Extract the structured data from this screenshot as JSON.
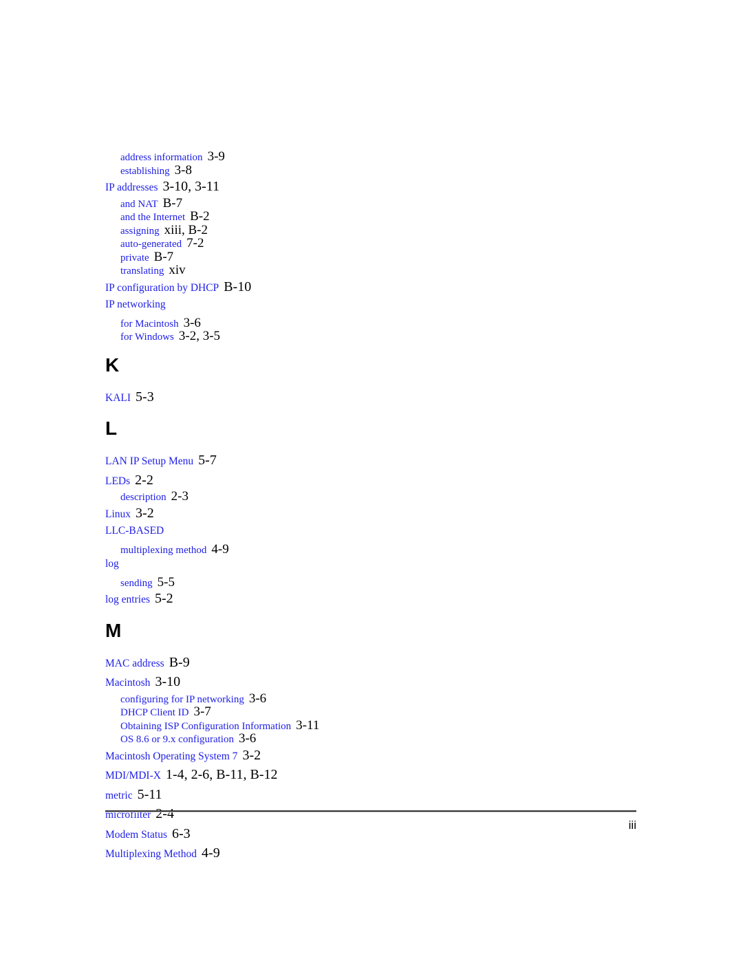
{
  "document": {
    "type": "book-index",
    "entry_color": "#2020e6",
    "page_number_color": "#000000",
    "heading_color": "#000000"
  },
  "blocks": [
    {
      "kind": "entries",
      "entries": [
        {
          "level": 1,
          "term": "address information",
          "pages": "3-9"
        },
        {
          "level": 1,
          "term": "establishing",
          "pages": "3-8"
        },
        {
          "level": 0,
          "term": "IP addresses",
          "pages": "3-10, 3-11"
        },
        {
          "level": 1,
          "term": "and NAT",
          "pages": "B-7"
        },
        {
          "level": 1,
          "term": "and the Internet",
          "pages": "B-2"
        },
        {
          "level": 1,
          "term": "assigning",
          "pages": "xiii, B-2"
        },
        {
          "level": 1,
          "term": "auto-generated",
          "pages": "7-2"
        },
        {
          "level": 1,
          "term": "private",
          "pages": "B-7"
        },
        {
          "level": 1,
          "term": "translating",
          "pages": "xiv"
        },
        {
          "level": 0,
          "term": "IP configuration by DHCP",
          "pages": "B-10"
        },
        {
          "level": 0,
          "term": "IP networking",
          "pages": ""
        },
        {
          "level": 1,
          "term": "for Macintosh",
          "pages": "3-6"
        },
        {
          "level": 1,
          "term": "for Windows",
          "pages": "3-2, 3-5"
        }
      ]
    },
    {
      "kind": "section",
      "letter": "K",
      "entries": [
        {
          "level": 0,
          "term": "KALI",
          "pages": "5-3"
        }
      ]
    },
    {
      "kind": "section",
      "letter": "L",
      "entries": [
        {
          "level": 0,
          "term": "LAN IP Setup Menu",
          "pages": "5-7"
        },
        {
          "level": 0,
          "term": "LEDs",
          "pages": "2-2"
        },
        {
          "level": 1,
          "term": "description",
          "pages": "2-3"
        },
        {
          "level": 0,
          "term": "Linux",
          "pages": "3-2"
        },
        {
          "level": 0,
          "term": "LLC-BASED",
          "pages": ""
        },
        {
          "level": 1,
          "term": "multiplexing method",
          "pages": "4-9"
        },
        {
          "level": 0,
          "term": "log",
          "pages": ""
        },
        {
          "level": 1,
          "term": "sending",
          "pages": "5-5"
        },
        {
          "level": 0,
          "term": "log entries",
          "pages": "5-2"
        }
      ]
    },
    {
      "kind": "section",
      "letter": "M",
      "entries": [
        {
          "level": 0,
          "term": "MAC address",
          "pages": "B-9"
        },
        {
          "level": 0,
          "term": "Macintosh",
          "pages": "3-10"
        },
        {
          "level": 1,
          "term": "configuring for IP networking",
          "pages": "3-6"
        },
        {
          "level": 1,
          "term": "DHCP Client ID",
          "pages": "3-7"
        },
        {
          "level": 1,
          "term": "Obtaining ISP Configuration Information",
          "pages": "3-11"
        },
        {
          "level": 1,
          "term": "OS 8.6 or 9.x configuration",
          "pages": "3-6"
        },
        {
          "level": 0,
          "term": "Macintosh Operating System 7",
          "pages": "3-2"
        },
        {
          "level": 0,
          "term": "MDI/MDI-X",
          "pages": "1-4, 2-6, B-11, B-12"
        },
        {
          "level": 0,
          "term": "metric",
          "pages": "5-11"
        },
        {
          "level": 0,
          "term": "microfilter",
          "pages": "2-4"
        },
        {
          "level": 0,
          "term": "Modem Status",
          "pages": "6-3"
        },
        {
          "level": 0,
          "term": "Multiplexing Method",
          "pages": "4-9"
        }
      ]
    }
  ],
  "footer": {
    "page_number": "iii"
  }
}
